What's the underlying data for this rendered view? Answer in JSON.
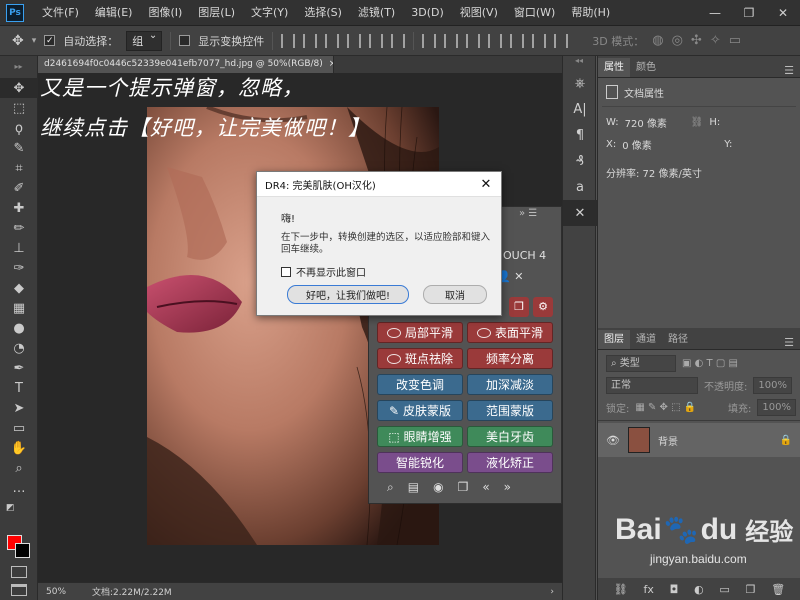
{
  "menubar": {
    "logo": "Ps",
    "items": [
      "文件(F)",
      "编辑(E)",
      "图像(I)",
      "图层(L)",
      "文字(Y)",
      "选择(S)",
      "滤镜(T)",
      "3D(D)",
      "视图(V)",
      "窗口(W)",
      "帮助(H)"
    ],
    "controls": [
      "—",
      "❐",
      "✕"
    ]
  },
  "optbar": {
    "auto_select_label": "自动选择：",
    "auto_select_value": "组",
    "show_transform_label": "显示变换控件",
    "mode_3d_label": "3D 模式："
  },
  "document": {
    "tab_title": "d2461694f0c0446c52339e041efb7077_hd.jpg @ 50%(RGB/8)",
    "tab_close": "×",
    "zoom": "50%",
    "doc_size": "文档:2.22M/2.22M"
  },
  "captions": {
    "line1": "又是一个提示弹窗，忽略，",
    "line2": "继续点击【好吧，让完美做吧！】"
  },
  "dialog": {
    "title": "DR4: 完美肌肤(OH汉化)",
    "greeting": "嗨!",
    "message": "在下一步中，转换创建的选区，以适应脸部和键入回车继续。",
    "checkbox_label": "不再显示此窗口",
    "ok_label": "好吧，让我们做吧!",
    "cancel_label": "取消"
  },
  "dr4_panel": {
    "header_fragment": "OUCH 4",
    "buttons": [
      {
        "label": "局部平滑",
        "color": "red",
        "icon": true
      },
      {
        "label": "表面平滑",
        "color": "red",
        "icon": true
      },
      {
        "label": "斑点祛除",
        "color": "red",
        "icon": true
      },
      {
        "label": "频率分离",
        "color": "red",
        "icon": false
      },
      {
        "label": "改变色调",
        "color": "blue",
        "icon": false
      },
      {
        "label": "加深减淡",
        "color": "blue",
        "icon": false
      },
      {
        "label": "皮肤蒙版",
        "color": "blue",
        "icon": true
      },
      {
        "label": "范围蒙版",
        "color": "blue",
        "icon": false
      },
      {
        "label": "眼睛增强",
        "color": "green",
        "icon": true
      },
      {
        "label": "美白牙齿",
        "color": "green",
        "icon": false
      },
      {
        "label": "智能锐化",
        "color": "purple",
        "icon": false
      },
      {
        "label": "液化矫正",
        "color": "purple",
        "icon": false
      }
    ],
    "footer_icons": [
      "zoom-icon",
      "frame-icon",
      "eye-icon",
      "copy-icon",
      "prev-icon",
      "next-icon"
    ],
    "footer_glyphs": [
      "⌕",
      "▤",
      "◉",
      "❐",
      "«",
      "»"
    ]
  },
  "properties_panel": {
    "tabs": [
      "属性",
      "颜色"
    ],
    "doc_props": "文档属性",
    "w_label": "W:",
    "w_value": "720 像素",
    "h_label": "H:",
    "x_label": "X:",
    "x_value": "0 像素",
    "y_label": "Y:",
    "resolution": "分辨率: 72 像素/英寸"
  },
  "layers_panel": {
    "tabs": [
      "图层",
      "通道",
      "路径"
    ],
    "filter_label": "类型",
    "blend_mode": "正常",
    "opacity_label": "不透明度:",
    "opacity_value": "100%",
    "lock_label": "锁定:",
    "fill_label": "填充:",
    "fill_value": "100%",
    "layer_name": "背景"
  },
  "watermark": {
    "brand": "Bai",
    "brand2": "du",
    "site_cn": "经验",
    "url": "jingyan.baidu.com"
  },
  "colors": {
    "foreground": "#ff0000",
    "background": "#000000",
    "menubar": "#323232",
    "panel": "#535353"
  }
}
